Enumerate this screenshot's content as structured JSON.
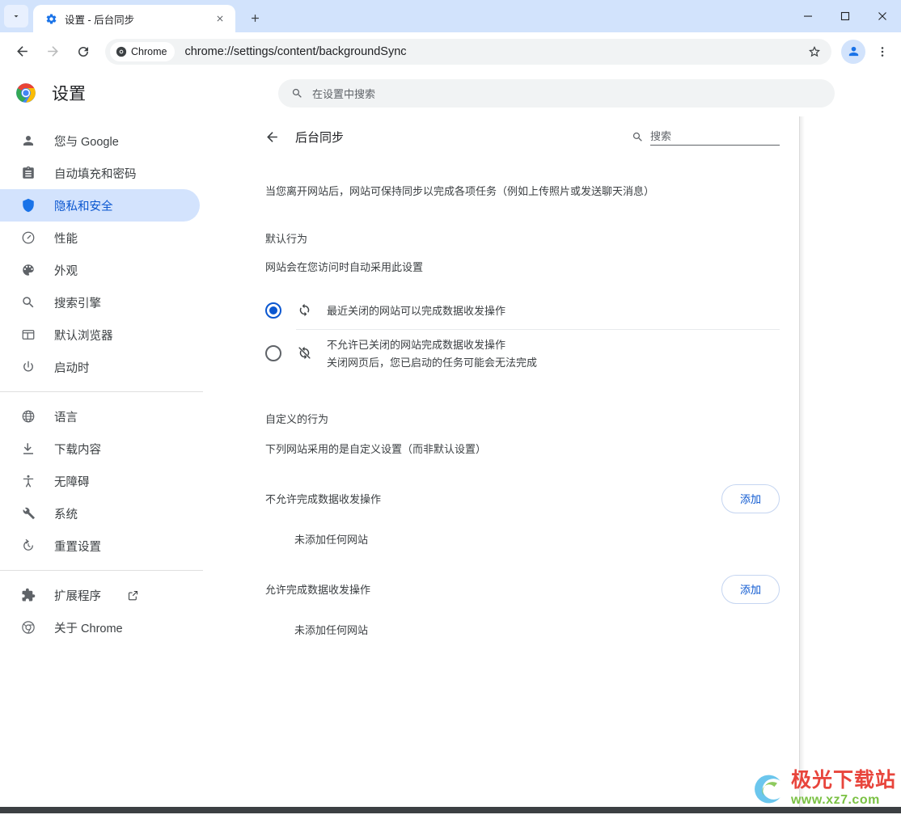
{
  "window": {
    "tab_search_icon": "chevron-down-icon",
    "tab": {
      "favicon": "settings-gear-icon",
      "title": "设置 - 后台同步",
      "close_icon": "close-icon"
    },
    "new_tab_label": "+",
    "controls": {
      "minimize": "minimize-icon",
      "maximize": "maximize-icon",
      "close": "close-icon"
    }
  },
  "toolbar": {
    "back_icon": "arrow-left-icon",
    "forward_icon": "arrow-right-icon",
    "reload_icon": "reload-icon",
    "chrome_pill_label": "Chrome",
    "chrome_pill_icon": "chrome-logo-icon",
    "url": "chrome://settings/content/backgroundSync",
    "bookmark_icon": "star-icon",
    "profile_icon": "person-icon",
    "menu_icon": "three-dot-menu-icon"
  },
  "settings_header": {
    "logo_icon": "chrome-logo-icon",
    "title": "设置",
    "search_icon": "search-icon",
    "search_placeholder": "在设置中搜索"
  },
  "sidebar": {
    "items": [
      {
        "label": "您与 Google",
        "icon": "person-icon",
        "active": false
      },
      {
        "label": "自动填充和密码",
        "icon": "clipboard-icon",
        "active": false
      },
      {
        "label": "隐私和安全",
        "icon": "shield-icon",
        "active": true
      },
      {
        "label": "性能",
        "icon": "speedometer-icon",
        "active": false
      },
      {
        "label": "外观",
        "icon": "palette-icon",
        "active": false
      },
      {
        "label": "搜索引擎",
        "icon": "search-icon",
        "active": false
      },
      {
        "label": "默认浏览器",
        "icon": "browser-window-icon",
        "active": false
      },
      {
        "label": "启动时",
        "icon": "power-icon",
        "active": false
      }
    ],
    "items_group2": [
      {
        "label": "语言",
        "icon": "globe-icon"
      },
      {
        "label": "下载内容",
        "icon": "download-icon"
      },
      {
        "label": "无障碍",
        "icon": "accessibility-icon"
      },
      {
        "label": "系统",
        "icon": "wrench-icon"
      },
      {
        "label": "重置设置",
        "icon": "history-restore-icon"
      }
    ],
    "items_group3": [
      {
        "label": "扩展程序",
        "icon": "puzzle-icon",
        "external_icon": "external-link-icon"
      },
      {
        "label": "关于 Chrome",
        "icon": "chrome-logo-icon",
        "external_icon": ""
      }
    ]
  },
  "main": {
    "back_icon": "arrow-left-icon",
    "title": "后台同步",
    "search_icon": "search-icon",
    "search_placeholder": "搜索",
    "description": "当您离开网站后，网站可保持同步以完成各项任务（例如上传照片或发送聊天消息）",
    "default_behavior": {
      "heading": "默认行为",
      "subtext": "网站会在您访问时自动采用此设置",
      "options": [
        {
          "label": "最近关闭的网站可以完成数据收发操作",
          "sublabel": "",
          "icon": "sync-icon",
          "selected": true
        },
        {
          "label": "不允许已关闭的网站完成数据收发操作",
          "sublabel": "关闭网页后，您已启动的任务可能会无法完成",
          "icon": "sync-disabled-icon",
          "selected": false
        }
      ]
    },
    "custom_behavior": {
      "heading": "自定义的行为",
      "subtext": "下列网站采用的是自定义设置（而非默认设置）",
      "blocks": [
        {
          "label": "不允许完成数据收发操作",
          "add_label": "添加",
          "empty_text": "未添加任何网站"
        },
        {
          "label": "允许完成数据收发操作",
          "add_label": "添加",
          "empty_text": "未添加任何网站"
        }
      ]
    }
  },
  "watermark": {
    "main": "极光下载站",
    "sub": "www.xz7.com",
    "icon": "aurora-logo-icon"
  },
  "colors": {
    "tabstrip_bg": "#d2e3fc",
    "accent_blue": "#1a73e8",
    "selected_blue": "#0b57d0",
    "nav_active_bg": "#d3e3fd",
    "omnibox_bg": "#f1f3f4",
    "text_primary": "#202124",
    "text_secondary": "#3c4043",
    "icon_grey": "#5f6368",
    "watermark_red": "#e8453c",
    "watermark_green": "#7ac143"
  }
}
